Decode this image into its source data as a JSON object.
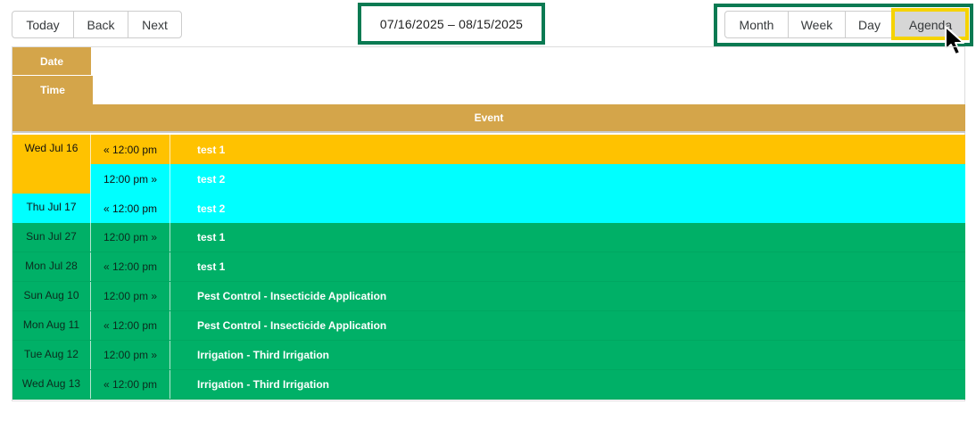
{
  "toolbar": {
    "today_label": "Today",
    "back_label": "Back",
    "next_label": "Next",
    "date_range": "07/16/2025 – 08/15/2025",
    "views": [
      "Month",
      "Week",
      "Day",
      "Agenda"
    ],
    "active_view": "Agenda"
  },
  "agenda": {
    "header_date": "Date",
    "header_time": "Time",
    "header_event": "Event",
    "rows": [
      {
        "date": "Wed Jul 16",
        "time": "« 12:00 pm",
        "title": "test 1",
        "color": "#ffc200"
      },
      {
        "date": "",
        "time": "12:00 pm »",
        "title": "test 2",
        "color": "#00ffff"
      },
      {
        "date": "Thu Jul 17",
        "time": "« 12:00 pm",
        "title": "test 2",
        "color": "#00ffff"
      },
      {
        "date": "Sun Jul 27",
        "time": "12:00 pm »",
        "title": "test 1",
        "color": "#00b067"
      },
      {
        "date": "Mon Jul 28",
        "time": "« 12:00 pm",
        "title": "test 1",
        "color": "#00b067"
      },
      {
        "date": "Sun Aug 10",
        "time": "12:00 pm »",
        "title": "Pest Control - Insecticide Application",
        "color": "#00b067"
      },
      {
        "date": "Mon Aug 11",
        "time": "« 12:00 pm",
        "title": "Pest Control - Insecticide Application",
        "color": "#00b067"
      },
      {
        "date": "Tue Aug 12",
        "time": "12:00 pm »",
        "title": "Irrigation - Third Irrigation",
        "color": "#00b067"
      },
      {
        "date": "Wed Aug 13",
        "time": "« 12:00 pm",
        "title": "Irrigation - Third Irrigation",
        "color": "#00b067"
      }
    ]
  },
  "colors": {
    "header": "#d4a54a",
    "annotation_box": "#0a7a52",
    "highlight": "#f5d300"
  },
  "icons": {
    "cursor": "mouse-pointer-icon"
  }
}
